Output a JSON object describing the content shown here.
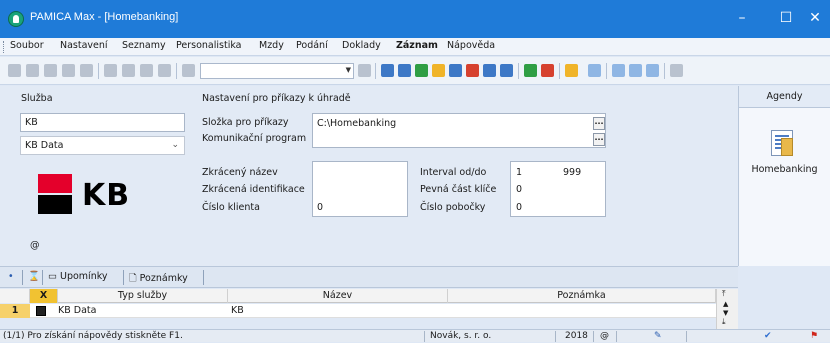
{
  "window": {
    "title": "PAMICA Max - [Homebanking]",
    "minimize_glyph": "–",
    "maximize_glyph": "☐",
    "close_glyph": "✕"
  },
  "menu": [
    "Soubor",
    "Nastavení",
    "Seznamy",
    "Personalistika",
    "Mzdy",
    "Podání",
    "Doklady",
    "Záznam",
    "Nápověda"
  ],
  "sluzba": {
    "section_label": "Služba",
    "name_value": "KB",
    "type_value": "KB Data",
    "logo_text": "KB",
    "at_symbol": "@"
  },
  "nastaveni": {
    "section_label": "Nastavení pro příkazy k úhradě",
    "folder_label": "Složka pro příkazy",
    "folder_value": "C:\\Homebanking",
    "program_label": "Komunikační program",
    "program_value": "",
    "short_name_label": "Zkrácený název",
    "short_name_value": "",
    "short_id_label": "Zkrácená identifikace",
    "client_no_label": "Číslo klienta",
    "client_no_value": "0",
    "interval_label": "Interval od/do",
    "interval_from": "1",
    "interval_to": "999",
    "fixed_key_label": "Pevná část klíče",
    "fixed_key_value": "0",
    "branch_label": "Číslo pobočky",
    "branch_value": "0",
    "ellipsis": "..."
  },
  "agendy": {
    "header": "Agendy",
    "item_label": "Homebanking"
  },
  "tabs": {
    "bullet": "•",
    "upominky": "Upomínky",
    "poznamky": "Poznámky"
  },
  "grid": {
    "headers": {
      "x": "X",
      "type": "Typ služby",
      "name": "Název",
      "note": "Poznámka"
    },
    "rows": [
      {
        "num": "1",
        "type": "KB Data",
        "name": "KB",
        "note": ""
      }
    ]
  },
  "status": {
    "help": "(1/1) Pro získání nápovědy stiskněte F1.",
    "company": "Novák, s. r. o.",
    "year": "2018",
    "at": "@"
  }
}
